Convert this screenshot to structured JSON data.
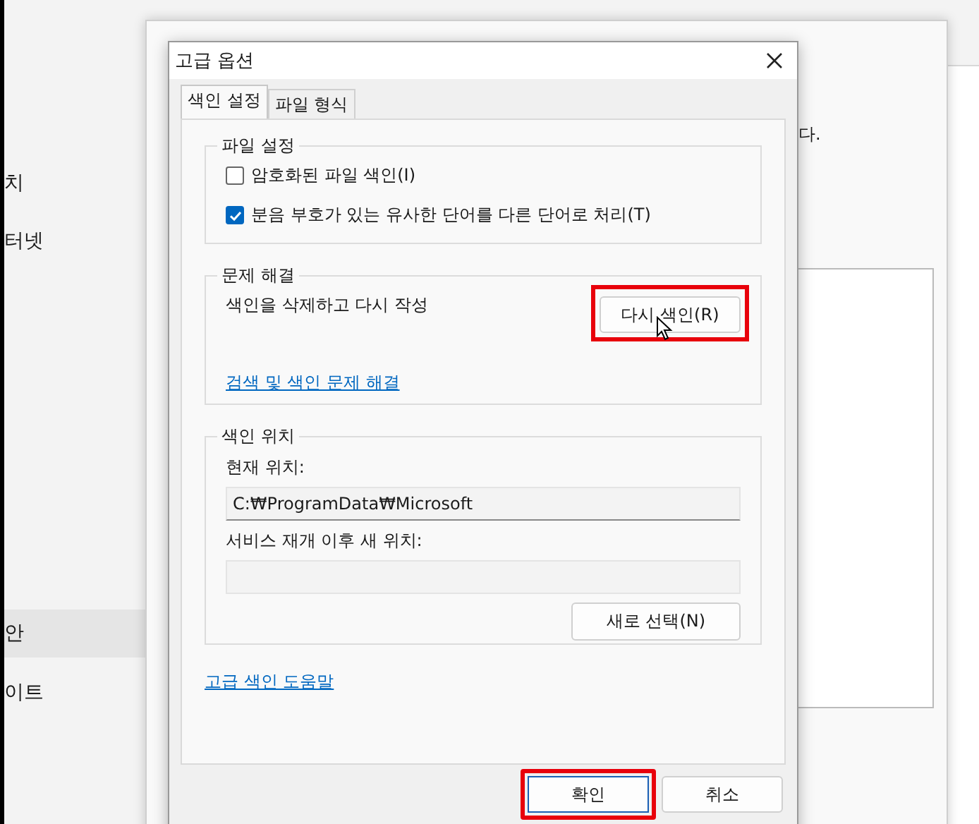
{
  "background": {
    "sidebar_items": [
      {
        "label": "치",
        "selected": false
      },
      {
        "label": "터넷",
        "selected": false
      },
      {
        "label": "안",
        "selected": true
      },
      {
        "label": "이트",
        "selected": false
      }
    ],
    "text_fragment": "다."
  },
  "dialog": {
    "title": "고급 옵션",
    "tabs": [
      {
        "label": "색인 설정",
        "selected": true
      },
      {
        "label": "파일 형식",
        "selected": false
      }
    ],
    "file_settings": {
      "title": "파일 설정",
      "options": [
        {
          "label": "암호화된 파일 색인(I)",
          "checked": false
        },
        {
          "label": "분음 부호가 있는 유사한 단어를 다른 단어로 처리(T)",
          "checked": true
        }
      ]
    },
    "troubleshooting": {
      "title": "문제 해결",
      "description": "색인을 삭제하고 다시 작성",
      "button": "다시 색인(R)",
      "button_highlighted": true,
      "link": "검색 및 색인 문제 해결"
    },
    "index_location": {
      "title": "색인 위치",
      "current_label": "현재 위치:",
      "current_value": "C:₩ProgramData₩Microsoft",
      "new_label": "서비스 재개 이후 새 위치:",
      "button": "새로 선택(N)"
    },
    "help_link": "고급 색인 도움말",
    "buttons": [
      {
        "label": "확인",
        "highlighted": true
      },
      {
        "label": "취소",
        "highlighted": false
      }
    ]
  }
}
